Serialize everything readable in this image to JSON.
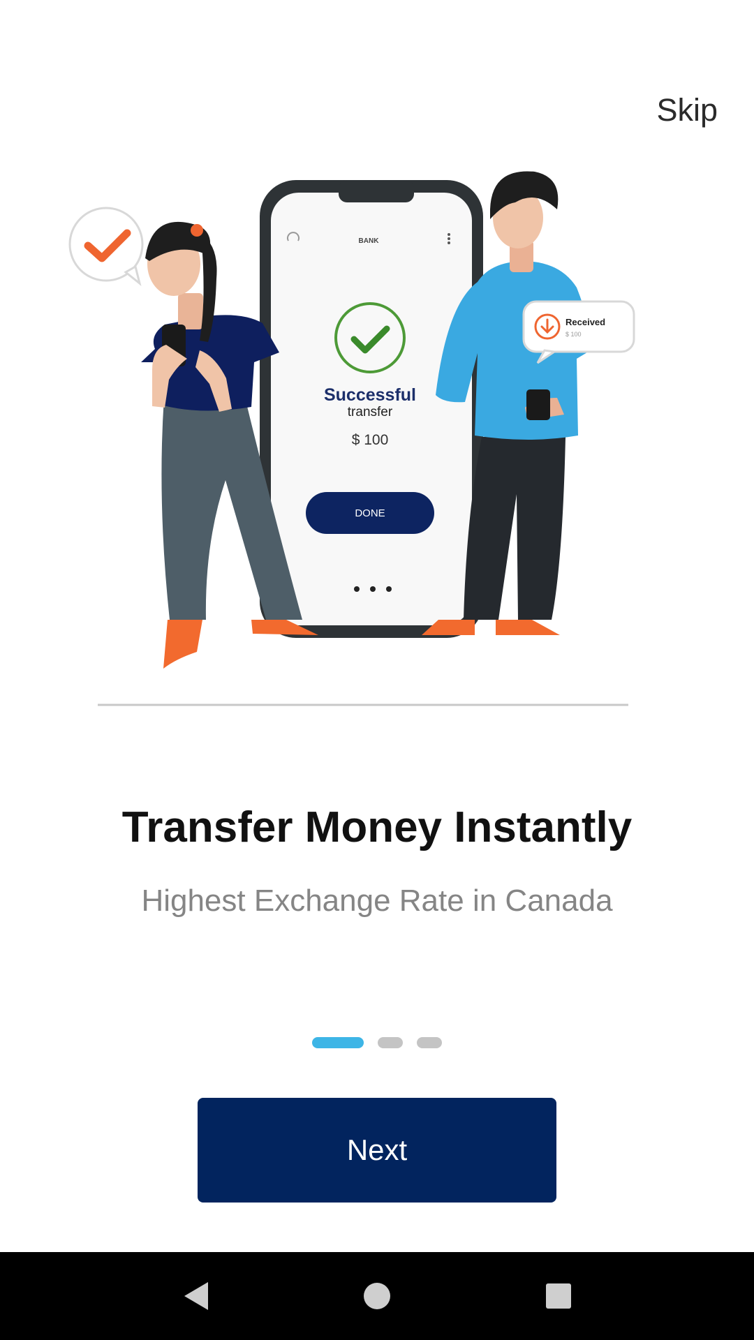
{
  "header": {
    "skip_label": "Skip"
  },
  "illustration": {
    "phone_app_label": "BANK",
    "success_title": "Successful",
    "success_subtitle": "transfer",
    "amount": "$ 100",
    "done_label": "DONE",
    "notification_title": "Received",
    "notification_amount": "$ 100"
  },
  "onboarding": {
    "title": "Transfer Money Instantly",
    "subtitle": "Highest Exchange Rate in Canada",
    "page_index": 1,
    "page_count": 3
  },
  "actions": {
    "next_label": "Next"
  },
  "colors": {
    "primary": "#02245e",
    "indicator_active": "#3db5e6",
    "indicator_inactive": "#c4c4c4",
    "accent_orange": "#f26a2e",
    "shirt_blue": "#3aa9e1"
  },
  "system_nav": {
    "icons": [
      "back-icon",
      "home-icon",
      "recents-icon"
    ]
  }
}
